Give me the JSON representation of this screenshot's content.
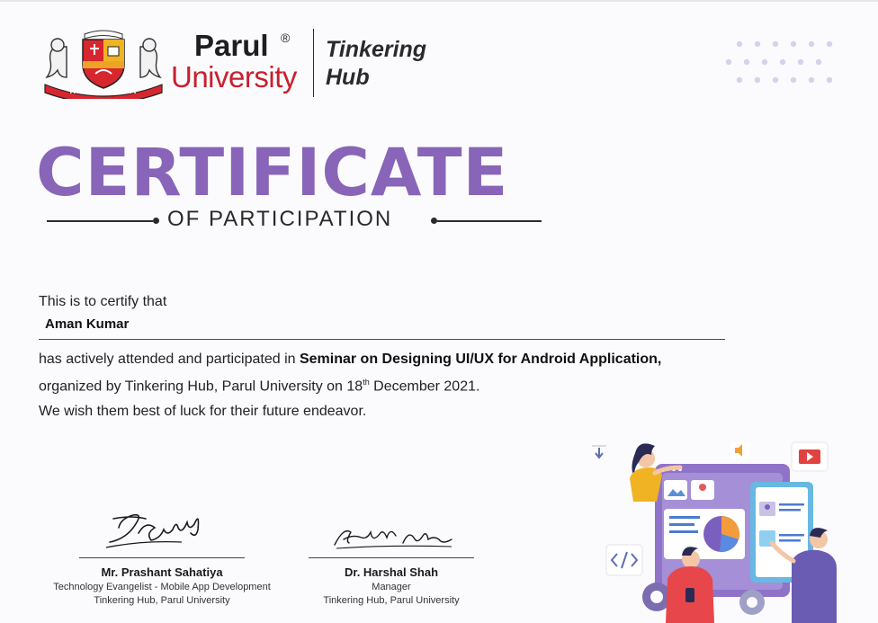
{
  "header": {
    "crest_banner": "PARUL UNIVERSITY",
    "crest_motto": "धर्म: कर्म परोपकार",
    "brand_parul": "Parul",
    "brand_registered": "®",
    "brand_university": "University",
    "hub_line1": "Tinkering",
    "hub_line2": "Hub"
  },
  "certificate": {
    "title": "CERTIFICATE",
    "subtitle": "OF PARTICIPATION"
  },
  "body": {
    "intro": "This is to certify that",
    "recipient": "Aman Kumar",
    "line1_prefix": "has actively attended and participated in ",
    "line1_event": "Seminar on Designing UI/UX for Android Application,",
    "line2_prefix": "organized by Tinkering Hub, Parul University on 18",
    "line2_superscript": "th",
    "line2_suffix": " December 2021.",
    "line3": "We wish them best of luck for their future endeavor."
  },
  "signatures": [
    {
      "signature_text": "Pv Sahatiya",
      "name": "Mr.  Prashant Sahatiya",
      "role": "Technology Evangelist - Mobile App Development",
      "org": "Tinkering Hub, Parul University"
    },
    {
      "signature_text": "Harshal Shah",
      "name": "Dr. Harshal Shah",
      "role": "Manager",
      "org": "Tinkering Hub, Parul University"
    }
  ],
  "colors": {
    "title_purple": "#8865b8",
    "brand_red": "#c8202f",
    "dot_lavender": "#d9d0ea"
  },
  "illustration": {
    "icons": [
      "download-arrow-icon",
      "speaker-icon",
      "play-icon",
      "code-icon",
      "image-icon",
      "pie-chart-icon",
      "user-icon",
      "gear-icon"
    ]
  }
}
